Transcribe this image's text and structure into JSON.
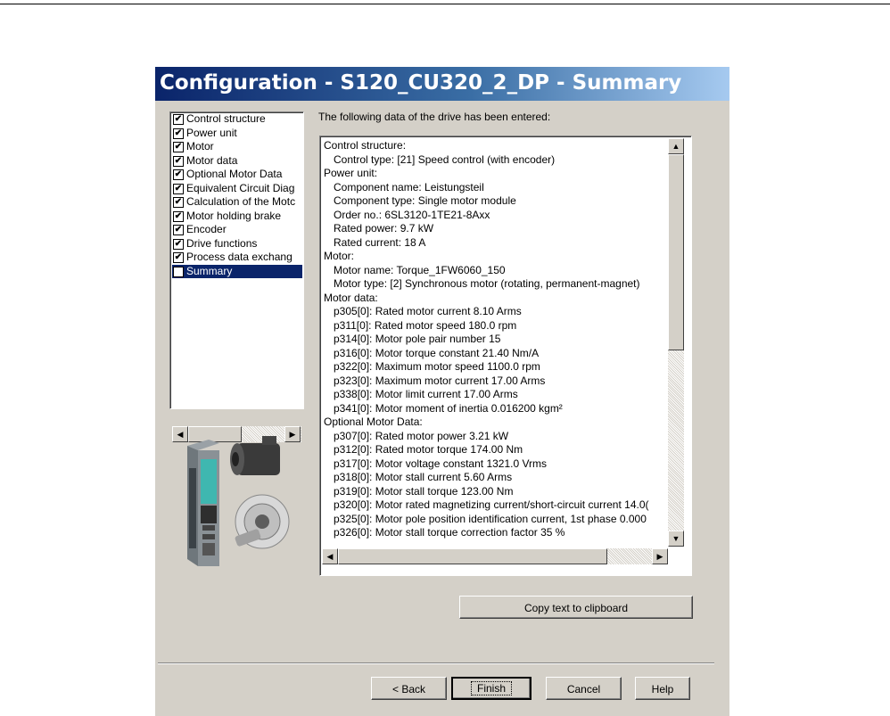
{
  "window": {
    "title": "Configuration - S120_CU320_2_DP - Summary"
  },
  "nav": {
    "items": [
      {
        "label": "Control structure",
        "checked": true
      },
      {
        "label": "Power unit",
        "checked": true
      },
      {
        "label": "Motor",
        "checked": true
      },
      {
        "label": "Motor data",
        "checked": true
      },
      {
        "label": "Optional Motor Data",
        "checked": true
      },
      {
        "label": "Equivalent Circuit Diag",
        "checked": true
      },
      {
        "label": "Calculation of the Motc",
        "checked": true
      },
      {
        "label": "Motor holding brake",
        "checked": true
      },
      {
        "label": "Encoder",
        "checked": true
      },
      {
        "label": "Drive functions",
        "checked": true
      },
      {
        "label": "Process data exchang",
        "checked": true
      },
      {
        "label": "Summary",
        "checked": false,
        "selected": true
      }
    ]
  },
  "main": {
    "intro": "The following data of the drive has been entered:",
    "lines": [
      {
        "text": "Control structure:",
        "indent": false
      },
      {
        "text": "Control type: [21] Speed control (with encoder)",
        "indent": true
      },
      {
        "text": "Power unit:",
        "indent": false
      },
      {
        "text": "Component name: Leistungsteil",
        "indent": true
      },
      {
        "text": "Component type: Single motor module",
        "indent": true
      },
      {
        "text": "Order no.: 6SL3120-1TE21-8Axx",
        "indent": true
      },
      {
        "text": "Rated power: 9.7 kW",
        "indent": true
      },
      {
        "text": "Rated current: 18 A",
        "indent": true
      },
      {
        "text": "Motor:",
        "indent": false
      },
      {
        "text": "Motor name: Torque_1FW6060_150",
        "indent": true
      },
      {
        "text": "Motor type: [2] Synchronous motor (rotating, permanent-magnet)",
        "indent": true
      },
      {
        "text": "Motor data:",
        "indent": false
      },
      {
        "text": "p305[0]: Rated motor current 8.10 Arms",
        "indent": true
      },
      {
        "text": "p311[0]: Rated motor speed 180.0 rpm",
        "indent": true
      },
      {
        "text": "p314[0]: Motor pole pair number 15",
        "indent": true
      },
      {
        "text": "p316[0]: Motor torque constant 21.40 Nm/A",
        "indent": true
      },
      {
        "text": "p322[0]: Maximum motor speed 1100.0 rpm",
        "indent": true
      },
      {
        "text": "p323[0]: Maximum motor current 17.00 Arms",
        "indent": true
      },
      {
        "text": "p338[0]: Motor limit current 17.00 Arms",
        "indent": true
      },
      {
        "text": "p341[0]: Motor moment of inertia 0.016200 kgm²",
        "indent": true
      },
      {
        "text": "Optional Motor Data:",
        "indent": false
      },
      {
        "text": "p307[0]: Rated motor power 3.21 kW",
        "indent": true
      },
      {
        "text": "p312[0]: Rated motor torque 174.00 Nm",
        "indent": true
      },
      {
        "text": "p317[0]: Motor voltage constant 1321.0 Vrms",
        "indent": true
      },
      {
        "text": "p318[0]: Motor stall current 5.60 Arms",
        "indent": true
      },
      {
        "text": "p319[0]: Motor stall torque 123.00 Nm",
        "indent": true
      },
      {
        "text": "p320[0]: Motor rated magnetizing current/short-circuit current 14.0(",
        "indent": true
      },
      {
        "text": "p325[0]: Motor pole position identification current, 1st phase 0.000",
        "indent": true
      },
      {
        "text": "p326[0]: Motor stall torque correction factor 35 %",
        "indent": true
      }
    ],
    "copy_label": "Copy text to clipboard"
  },
  "footer": {
    "back": "< Back",
    "finish": "Finish",
    "cancel": "Cancel",
    "help": "Help"
  }
}
